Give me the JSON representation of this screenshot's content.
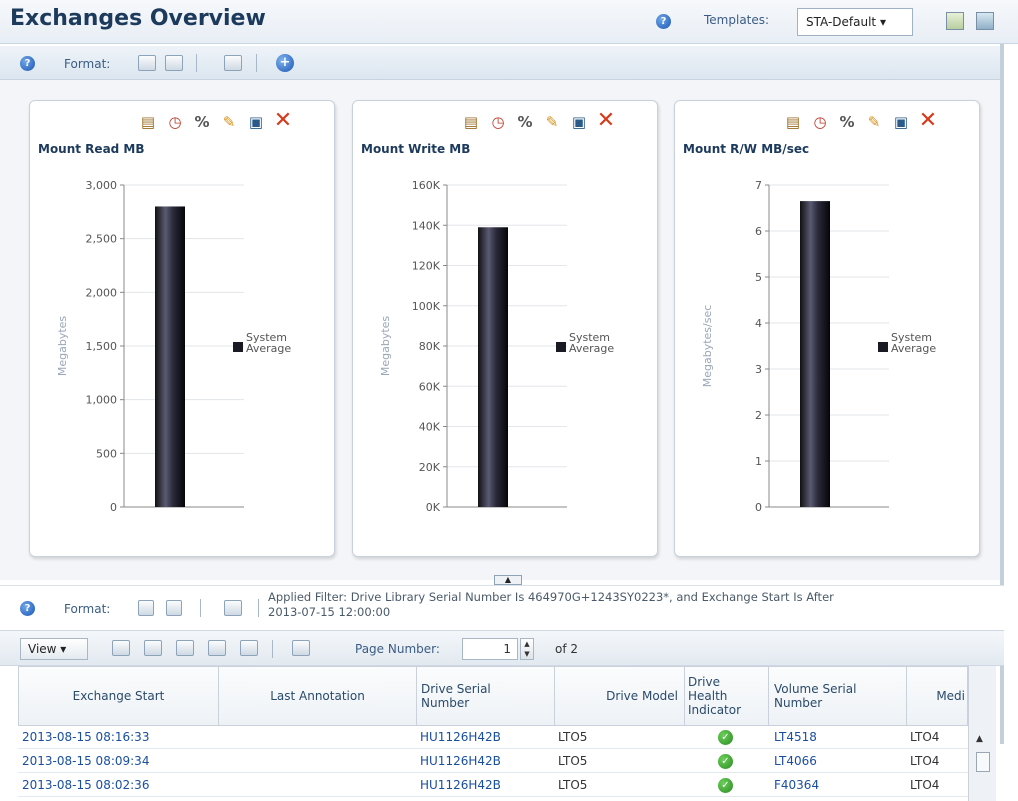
{
  "header": {
    "title": "Exchanges Overview",
    "templates_label": "Templates:",
    "templates_value": "STA-Default ▾"
  },
  "format_bar": {
    "label": "Format:"
  },
  "charts": [
    {
      "title": "Mount Read MB",
      "ylabel": "Megabytes",
      "ticks": [
        "3,000",
        "2,500",
        "2,000",
        "1,500",
        "1,000",
        "500",
        "0"
      ],
      "ymax": 3000,
      "value": 2800,
      "legend": [
        "System",
        "Average"
      ]
    },
    {
      "title": "Mount Write MB",
      "ylabel": "Megabytes",
      "ticks": [
        "160K",
        "140K",
        "120K",
        "100K",
        "80K",
        "60K",
        "40K",
        "20K",
        "0K"
      ],
      "ymax": 160000,
      "value": 139000,
      "legend": [
        "System",
        "Average"
      ]
    },
    {
      "title": "Mount R/W MB/sec",
      "ylabel": "Megabytes/sec",
      "ticks": [
        "7",
        "6",
        "5",
        "4",
        "3",
        "2",
        "1",
        "0"
      ],
      "ymax": 7,
      "value": 6.65,
      "legend": [
        "System",
        "Average"
      ]
    }
  ],
  "chart_data": [
    {
      "type": "bar",
      "title": "Mount Read MB",
      "ylabel": "Megabytes",
      "categories": [
        "System Average"
      ],
      "values": [
        2800
      ],
      "ylim": [
        0,
        3000
      ],
      "legend": "right"
    },
    {
      "type": "bar",
      "title": "Mount Write MB",
      "ylabel": "Megabytes",
      "categories": [
        "System Average"
      ],
      "values": [
        139000
      ],
      "ylim": [
        0,
        160000
      ],
      "legend": "right"
    },
    {
      "type": "bar",
      "title": "Mount R/W MB/sec",
      "ylabel": "Megabytes/sec",
      "categories": [
        "System Average"
      ],
      "values": [
        6.65
      ],
      "ylim": [
        0,
        7
      ],
      "legend": "right"
    }
  ],
  "table_section": {
    "format_label": "Format:",
    "filter_line1": "Applied Filter: Drive Library Serial Number Is 464970G+1243SY0223*, and Exchange Start Is After",
    "filter_line2": "2013-07-15 12:00:00",
    "view_label": "View ▾",
    "page_label": "Page Number:",
    "page_value": "1",
    "of_label": "of 2"
  },
  "table": {
    "columns": [
      "Exchange Start",
      "Last Annotation",
      "Drive Serial Number",
      "Drive Model",
      "Drive Health Indicator",
      "Volume Serial Number",
      "Medi"
    ],
    "rows": [
      [
        "2013-08-15 08:16:33",
        "",
        "HU1126H42B",
        "LTO5",
        "ok",
        "LT4518",
        "LTO4"
      ],
      [
        "2013-08-15 08:09:34",
        "",
        "HU1126H42B",
        "LTO5",
        "ok",
        "LT4066",
        "LTO4"
      ],
      [
        "2013-08-15 08:02:36",
        "",
        "HU1126H42B",
        "LTO5",
        "ok",
        "F40364",
        "LTO4"
      ]
    ]
  },
  "icons": {
    "help": "help-icon",
    "check": "check-icon"
  }
}
